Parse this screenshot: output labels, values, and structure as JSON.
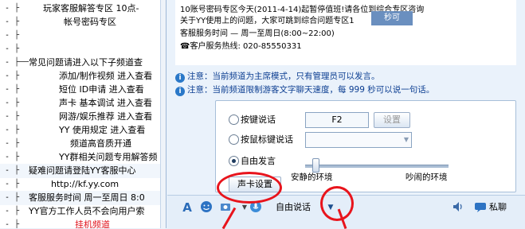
{
  "sidebar": {
    "items": [
      {
        "mark": "-",
        "tree": "├",
        "label": "玩家客服解答专区  10点-",
        "indent": 54,
        "red": false,
        "hl": false
      },
      {
        "mark": "-",
        "tree": "├",
        "label": "帐号密码专区",
        "indent": 80,
        "red": false,
        "hl": false
      },
      {
        "mark": "-",
        "tree": "├",
        "label": "",
        "indent": 40,
        "red": false,
        "hl": false
      },
      {
        "mark": "-",
        "tree": "├",
        "label": "",
        "indent": 40,
        "red": false,
        "hl": false
      },
      {
        "mark": "-",
        "tree": "├──",
        "label": "常见问题请进入以下子频道查",
        "indent": 36,
        "red": false,
        "hl": false
      },
      {
        "mark": "-",
        "tree": "├",
        "label": "添加/制作视频   进入查看",
        "indent": 74,
        "red": false,
        "hl": false
      },
      {
        "mark": "-",
        "tree": "├",
        "label": "短位 ID申请   进入查看",
        "indent": 74,
        "red": false,
        "hl": false
      },
      {
        "mark": "-",
        "tree": "├",
        "label": "声卡 基本调试   进入查看",
        "indent": 74,
        "red": false,
        "hl": false
      },
      {
        "mark": "-",
        "tree": "├",
        "label": "网游/娱乐推荐  进入查看",
        "indent": 74,
        "red": false,
        "hl": false
      },
      {
        "mark": "-",
        "tree": "├",
        "label": "YY 使用规定   进入查看",
        "indent": 74,
        "red": false,
        "hl": false
      },
      {
        "mark": "-",
        "tree": "├",
        "label": "频道高音质开通",
        "indent": 88,
        "red": false,
        "hl": false
      },
      {
        "mark": "-",
        "tree": "├",
        "label": "YY群相关问题专用解答频",
        "indent": 74,
        "red": false,
        "hl": false
      },
      {
        "mark": "-",
        "tree": "├",
        "label": "疑难问题请登陆YY客服中心",
        "indent": 36,
        "red": false,
        "hl": true
      },
      {
        "mark": "-",
        "tree": "├",
        "label": "http://kf.yy.com",
        "indent": 64,
        "red": false,
        "hl": false
      },
      {
        "mark": "-",
        "tree": "├",
        "label": "客服服务时间  周一至周日 8:0",
        "indent": 36,
        "red": false,
        "hl": true
      },
      {
        "mark": "-",
        "tree": "├",
        "label": "YY官方工作人员不会向用户索",
        "indent": 36,
        "red": false,
        "hl": false
      },
      {
        "mark": "-",
        "tree": "├",
        "label": "挂机频道",
        "indent": 94,
        "red": true,
        "hl": false
      }
    ]
  },
  "bulletin": {
    "lines": [
      "10账号密码专区今天(2011-4-14)起暂停值班!请各位到综合专区咨询",
      "关于YY使用上的问题，大家可跳到综合问题专区1",
      "客服服务时间 — 周一至周日(8:00~22:00)",
      "☎客户服务热线: 020-85550331"
    ],
    "overlay": "秒可"
  },
  "notices": [
    "注意：当前频道为主席模式，只有管理员可以发言。",
    "注意：当前频道限制游客文字聊天速度，每 999 秒可以说一句话。"
  ],
  "voice_panel": {
    "options": [
      {
        "label": "按键说话",
        "selected": false
      },
      {
        "label": "按鼠标键说话",
        "selected": false
      },
      {
        "label": "自由发言",
        "selected": true
      }
    ],
    "hotkey_value": "F2",
    "set_button": "设置",
    "slider_left_label": "安静的环境",
    "slider_right_label": "吵闹的环境",
    "slider_value": 0.05,
    "soundcard_button": "声卡设置"
  },
  "toolbar": {
    "mode_label": "自由说话",
    "private_chat": "私聊",
    "mode_dropdown_icon": "triangle-down"
  },
  "colors": {
    "annotation_red": "#e8141c",
    "notice_blue": "#0b3d91",
    "sidebar_red": "#e0101a"
  }
}
